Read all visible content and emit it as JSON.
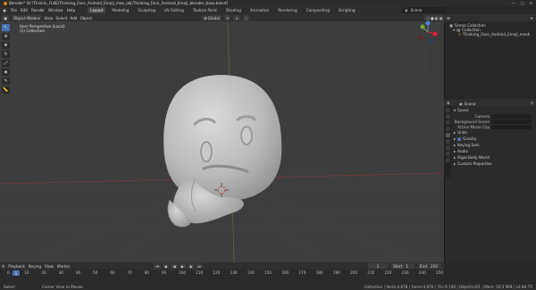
{
  "window": {
    "title": "Blender* [H:\\Thinkin_FLBE\\Thinking_Face_Android_Emoji_max_obj\\Thinking_Face_Android_Emoji_blender_base.blend]",
    "controls": [
      "—",
      "□",
      "✕"
    ]
  },
  "menu": [
    "File",
    "Edit",
    "Render",
    "Window",
    "Help"
  ],
  "workspaces": [
    "Layout",
    "Modeling",
    "Sculpting",
    "UV Editing",
    "Texture Paint",
    "Shading",
    "Animation",
    "Rendering",
    "Compositing",
    "Scripting"
  ],
  "active_workspace": "Layout",
  "scene": {
    "label": "Scene"
  },
  "view_layer": {
    "label": "View Layer"
  },
  "viewport_header": {
    "mode": "Object Mode",
    "menus": [
      "View",
      "Select",
      "Add",
      "Object"
    ],
    "orientation": "Global"
  },
  "viewport_info": {
    "line1": "User Perspective (Local)",
    "line2": "(1) Collection"
  },
  "tools": [
    "select-box-icon",
    "cursor-icon",
    "move-icon",
    "rotate-icon",
    "scale-icon",
    "transform-icon",
    "annotate-icon",
    "measure-icon"
  ],
  "gizmo": {
    "axes": [
      "X",
      "Y",
      "Z"
    ]
  },
  "outliner": {
    "root": "Scene Collection",
    "items": [
      {
        "label": "Collection"
      },
      {
        "label": "Thinking_Face_Android_Emoji_mesh"
      }
    ]
  },
  "properties": {
    "header": "Scene",
    "sections": [
      {
        "label": "Scene",
        "fields": [
          {
            "label": "Camera"
          },
          {
            "label": "Background Scene"
          },
          {
            "label": "Active Movie Clip"
          }
        ]
      },
      {
        "label": "Units"
      },
      {
        "label": "Gravity",
        "checkbox": true
      },
      {
        "label": "Keying Sets"
      },
      {
        "label": "Audio"
      },
      {
        "label": "Rigid Body World"
      },
      {
        "label": "Custom Properties"
      }
    ]
  },
  "timeline_header": {
    "menus": [
      "Playback",
      "Keying",
      "View",
      "Marker"
    ],
    "current_frame": "1",
    "start_label": "Start",
    "start": "1",
    "end_label": "End",
    "end": "250"
  },
  "timeline_ticks": [
    "0",
    "10",
    "20",
    "30",
    "40",
    "50",
    "60",
    "70",
    "80",
    "90",
    "100",
    "110",
    "120",
    "130",
    "140",
    "150",
    "160",
    "170",
    "180",
    "190",
    "200",
    "210",
    "220",
    "230",
    "240",
    "250"
  ],
  "status": {
    "left": "Select",
    "middle": "Center View to Mouse",
    "right": "Collection | Verts:4,878 | Faces:4,870 | Tris:9,740 | Objects:0/1 | Mem: 20.5 MiB | v2.80.75"
  }
}
